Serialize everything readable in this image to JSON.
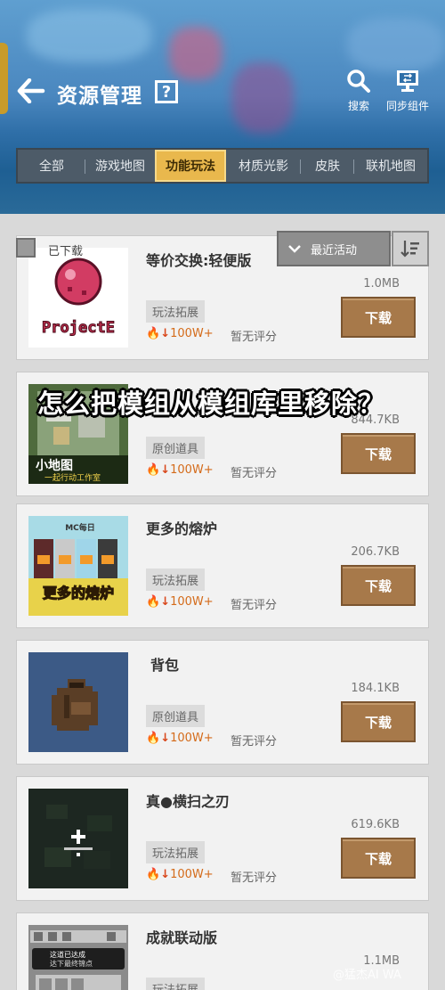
{
  "header": {
    "title": "资源管理",
    "help_icon": "?",
    "search_label": "搜索",
    "sync_label": "同步组件"
  },
  "tabs": [
    {
      "label": "全部",
      "active": false
    },
    {
      "label": "游戏地图",
      "active": false
    },
    {
      "label": "功能玩法",
      "active": true
    },
    {
      "label": "材质光影",
      "active": false
    },
    {
      "label": "皮肤",
      "active": false
    },
    {
      "label": "联机地图",
      "active": false
    }
  ],
  "filter": {
    "downloaded_label": "已下载",
    "sort_selected": "最近活动"
  },
  "items": [
    {
      "name": "等价交换:轻便版",
      "size": "1.0MB",
      "tag": "玩法拓展",
      "downloads": "100W+",
      "rating": "暂无评分",
      "button": "下载",
      "thumb_text": "ProjectE"
    },
    {
      "name": "",
      "size": "844.7KB",
      "tag": "原创道具",
      "downloads": "100W+",
      "rating": "暂无评分",
      "button": "下载",
      "thumb_text": "小地图",
      "thumb_sub": "一起行动工作室"
    },
    {
      "name": "更多的熔炉",
      "size": "206.7KB",
      "tag": "玩法拓展",
      "downloads": "100W+",
      "rating": "暂无评分",
      "button": "下载",
      "thumb_text": "更多的熔炉",
      "thumb_sub": "MC每日"
    },
    {
      "name": "背包",
      "size": "184.1KB",
      "tag": "原创道具",
      "downloads": "100W+",
      "rating": "暂无评分",
      "button": "下载"
    },
    {
      "name": "真●横扫之刃",
      "size": "619.6KB",
      "tag": "玩法拓展",
      "downloads": "100W+",
      "rating": "暂无评分",
      "button": "下载"
    },
    {
      "name": "成就联动版",
      "size": "1.1MB",
      "tag": "玩法拓展",
      "downloads": "",
      "rating": "",
      "button": "",
      "thumb_text": "这道已达成",
      "thumb_sub": "达下最终锦点"
    }
  ],
  "overlay_question": "怎么把模组从模组库里移除？",
  "watermark": "@猛杰AI WA",
  "colors": {
    "accent_tab": "#e9b84d",
    "download_button": "#a7794a",
    "fire": "#e3621b",
    "arrow_down": "#d8461a"
  }
}
